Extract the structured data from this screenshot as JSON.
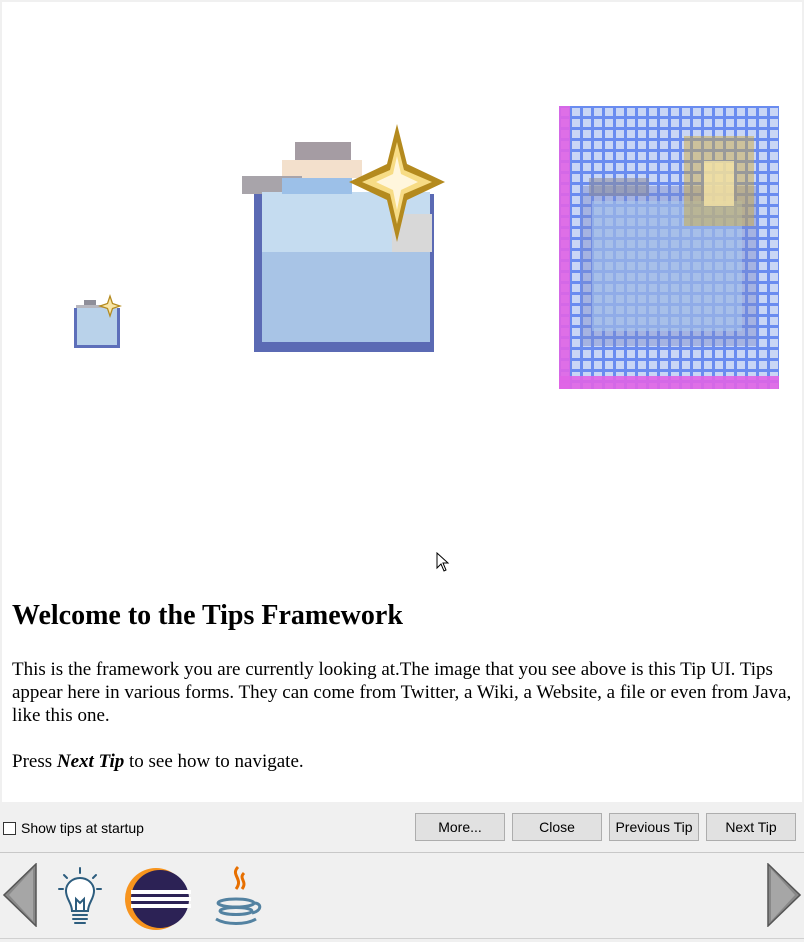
{
  "tip": {
    "title": "Welcome to the Tips Framework",
    "paragraph1": "This is the framework you are currently looking at.The image that you see above is this Tip UI. Tips appear here in various forms. They can come from Twitter, a Wiki, a Website, a file or even from Java, like this one.",
    "press_prefix": "Press ",
    "press_emphasis": "Next Tip",
    "press_suffix": " to see how to navigate.",
    "images": [
      "new-project-icon-small",
      "new-project-icon-large",
      "new-project-icon-pixel-grid"
    ]
  },
  "footer": {
    "show_tips_label": "Show tips at startup",
    "show_tips_checked": false,
    "buttons": {
      "more": "More...",
      "close": "Close",
      "previous": "Previous Tip",
      "next": "Next Tip"
    }
  },
  "provider_strip": {
    "items": [
      "lightbulb-icon",
      "eclipse-icon",
      "java-icon"
    ],
    "scroll_left_icon": "arrow-left-icon",
    "scroll_right_icon": "arrow-right-icon"
  },
  "colors": {
    "content_bg": "#ffffff",
    "chrome_bg": "#f0f0f0",
    "button_bg": "#e1e1e1",
    "button_border": "#adadad",
    "accent_blue": "#5b6fb8",
    "accent_gold": "#b8901e"
  }
}
